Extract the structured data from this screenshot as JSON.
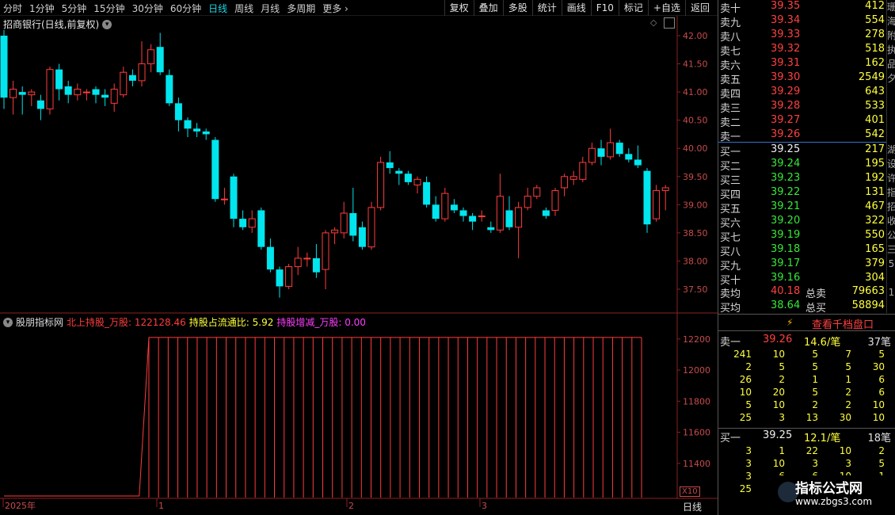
{
  "toolbar": {
    "periods": [
      "分时",
      "1分钟",
      "5分钟",
      "15分钟",
      "30分钟",
      "60分钟",
      "日线",
      "周线",
      "月线",
      "多周期",
      "更多"
    ],
    "active_period": "日线",
    "tools": [
      "复权",
      "叠加",
      "多股",
      "统计",
      "画线",
      "F10",
      "标记",
      "+自选",
      "返回"
    ]
  },
  "main_chart": {
    "title": "招商银行(日线,前复权)",
    "y_ticks": [
      "42.00",
      "41.50",
      "41.00",
      "40.50",
      "40.00",
      "39.50",
      "39.00",
      "38.50",
      "38.00",
      "37.50"
    ]
  },
  "chart_data": [
    {
      "type": "candlestick",
      "y_ticks": [
        42.0,
        41.5,
        41.0,
        40.5,
        40.0,
        39.5,
        39.0,
        38.5,
        38.0,
        37.5
      ],
      "ylim": [
        37.3,
        42.3
      ],
      "candles": [
        [
          42.0,
          40.9,
          42.1,
          40.7
        ],
        [
          40.9,
          41.05,
          41.2,
          40.6
        ],
        [
          41.0,
          40.95,
          41.1,
          40.6
        ],
        [
          40.95,
          41.0,
          41.05,
          40.75
        ],
        [
          40.85,
          40.7,
          40.95,
          40.5
        ],
        [
          40.7,
          41.4,
          41.45,
          40.6
        ],
        [
          41.4,
          41.05,
          41.5,
          40.85
        ],
        [
          41.1,
          40.95,
          41.2,
          40.8
        ],
        [
          40.95,
          41.05,
          41.15,
          40.85
        ],
        [
          41.0,
          41.0,
          41.05,
          40.85
        ],
        [
          41.05,
          40.95,
          41.1,
          40.8
        ],
        [
          40.95,
          40.9,
          41.05,
          40.75
        ],
        [
          40.8,
          41.05,
          41.15,
          40.65
        ],
        [
          40.95,
          41.35,
          41.45,
          40.9
        ],
        [
          41.3,
          41.2,
          41.4,
          41.1
        ],
        [
          41.2,
          41.5,
          41.9,
          41.1
        ],
        [
          41.5,
          41.75,
          41.85,
          41.35
        ],
        [
          41.8,
          41.35,
          42.05,
          41.3
        ],
        [
          41.3,
          40.8,
          41.4,
          40.75
        ],
        [
          40.8,
          40.5,
          40.9,
          40.3
        ],
        [
          40.5,
          40.35,
          40.55,
          40.2
        ],
        [
          40.35,
          40.3,
          40.45,
          40.2
        ],
        [
          40.3,
          40.25,
          40.35,
          40.15
        ],
        [
          40.15,
          39.1,
          40.2,
          39.05
        ],
        [
          39.1,
          39.1,
          39.3,
          39.0
        ],
        [
          39.5,
          38.75,
          39.55,
          38.6
        ],
        [
          38.75,
          38.6,
          38.9,
          38.55
        ],
        [
          38.6,
          38.75,
          38.9,
          38.5
        ],
        [
          38.9,
          38.25,
          38.95,
          38.2
        ],
        [
          38.25,
          37.85,
          38.4,
          37.8
        ],
        [
          37.85,
          37.55,
          37.9,
          37.35
        ],
        [
          37.55,
          37.9,
          37.95,
          37.5
        ],
        [
          37.9,
          38.05,
          38.25,
          37.75
        ],
        [
          38.05,
          38.05,
          38.15,
          37.9
        ],
        [
          38.05,
          37.8,
          38.3,
          37.7
        ],
        [
          37.85,
          38.5,
          38.55,
          37.5
        ],
        [
          38.5,
          38.55,
          38.6,
          38.3
        ],
        [
          38.5,
          38.85,
          39.05,
          38.4
        ],
        [
          38.85,
          38.45,
          39.3,
          38.35
        ],
        [
          38.6,
          38.25,
          38.7,
          38.2
        ],
        [
          38.25,
          38.95,
          39.05,
          38.2
        ],
        [
          38.95,
          39.75,
          39.85,
          38.9
        ],
        [
          39.75,
          39.65,
          39.95,
          39.55
        ],
        [
          39.6,
          39.55,
          39.65,
          39.35
        ],
        [
          39.55,
          39.4,
          39.6,
          39.35
        ],
        [
          39.35,
          39.45,
          39.5,
          39.2
        ],
        [
          39.4,
          39.0,
          39.5,
          38.95
        ],
        [
          39.0,
          38.75,
          39.15,
          38.7
        ],
        [
          38.75,
          39.2,
          39.3,
          38.7
        ],
        [
          39.0,
          38.9,
          39.1,
          38.85
        ],
        [
          38.9,
          38.8,
          38.95,
          38.7
        ],
        [
          38.8,
          38.7,
          38.85,
          38.55
        ],
        [
          38.8,
          38.8,
          38.9,
          38.7
        ],
        [
          38.6,
          38.55,
          38.7,
          38.5
        ],
        [
          38.55,
          39.15,
          39.55,
          38.5
        ],
        [
          38.9,
          38.6,
          39.15,
          38.55
        ],
        [
          38.6,
          38.95,
          39.05,
          38.05
        ],
        [
          38.95,
          39.15,
          39.3,
          38.9
        ],
        [
          39.15,
          39.3,
          39.35,
          39.1
        ],
        [
          38.9,
          38.8,
          38.95,
          38.75
        ],
        [
          38.9,
          39.25,
          39.3,
          38.8
        ],
        [
          39.3,
          39.5,
          39.55,
          39.15
        ],
        [
          39.45,
          39.5,
          39.6,
          39.35
        ],
        [
          39.45,
          39.75,
          39.85,
          39.4
        ],
        [
          39.75,
          40.0,
          40.1,
          39.7
        ],
        [
          40.0,
          39.85,
          40.15,
          39.7
        ],
        [
          39.85,
          40.1,
          40.35,
          39.8
        ],
        [
          40.1,
          39.9,
          40.15,
          39.85
        ],
        [
          39.9,
          39.8,
          40.0,
          39.75
        ],
        [
          39.8,
          39.7,
          40.05,
          39.65
        ],
        [
          39.6,
          38.65,
          39.65,
          38.5
        ],
        [
          38.75,
          39.25,
          39.35,
          38.7
        ],
        [
          39.25,
          39.3,
          39.35,
          38.9
        ]
      ]
    },
    {
      "type": "area",
      "y_ticks": [
        12200,
        12000,
        11800,
        11600,
        11400
      ],
      "ylim": [
        11180,
        12240
      ],
      "values": [
        11190,
        11190,
        11190,
        11190,
        11190,
        11190,
        11190,
        11190,
        11190,
        11190,
        11190,
        11190,
        11190,
        11190,
        11190,
        12210,
        12210,
        12210,
        12210,
        12210,
        12210,
        12210,
        12210,
        12210,
        12210,
        12210,
        12210,
        12210,
        12210,
        12210,
        12210,
        12210,
        12210,
        12210,
        12210,
        12210,
        12210,
        12210,
        12210,
        12210,
        12210,
        12210,
        12210,
        12210,
        12210,
        12210,
        12210,
        12210,
        12210,
        12210,
        12210,
        12210,
        12210,
        12210,
        12210,
        12210,
        12210,
        12210,
        12210,
        12210,
        12210,
        12210,
        12210,
        12210,
        12210,
        12210,
        12210
      ]
    }
  ],
  "indicator": {
    "name": "股朋指标网",
    "line1": "北上持股_万股: 122128.46",
    "line2": "持股占流通比: 5.92",
    "line3": "持股增减_万股: 0.00",
    "y_ticks": [
      "12200",
      "12000",
      "11800",
      "11600",
      "11400"
    ]
  },
  "x_axis": {
    "labels": [
      "2025年",
      "1",
      "2",
      "3"
    ],
    "scale": "X10",
    "tab": "日线"
  },
  "orderbook": {
    "asks": [
      {
        "label": "卖十",
        "price": "39.35",
        "vol": "412"
      },
      {
        "label": "卖九",
        "price": "39.34",
        "vol": "554"
      },
      {
        "label": "卖八",
        "price": "39.33",
        "vol": "278"
      },
      {
        "label": "卖七",
        "price": "39.32",
        "vol": "518"
      },
      {
        "label": "卖六",
        "price": "39.31",
        "vol": "162"
      },
      {
        "label": "卖五",
        "price": "39.30",
        "vol": "2549"
      },
      {
        "label": "卖四",
        "price": "39.29",
        "vol": "643"
      },
      {
        "label": "卖三",
        "price": "39.28",
        "vol": "533"
      },
      {
        "label": "卖二",
        "price": "39.27",
        "vol": "401"
      },
      {
        "label": "卖一",
        "price": "39.26",
        "vol": "542"
      }
    ],
    "bids": [
      {
        "label": "买一",
        "price": "39.25",
        "vol": "217"
      },
      {
        "label": "买二",
        "price": "39.24",
        "vol": "195"
      },
      {
        "label": "买三",
        "price": "39.23",
        "vol": "192"
      },
      {
        "label": "买四",
        "price": "39.22",
        "vol": "131"
      },
      {
        "label": "买五",
        "price": "39.21",
        "vol": "467"
      },
      {
        "label": "买六",
        "price": "39.20",
        "vol": "322"
      },
      {
        "label": "买七",
        "price": "39.19",
        "vol": "550"
      },
      {
        "label": "买八",
        "price": "39.18",
        "vol": "165"
      },
      {
        "label": "买九",
        "price": "39.17",
        "vol": "379"
      },
      {
        "label": "买十",
        "price": "39.16",
        "vol": "304"
      }
    ],
    "side_strip": [
      "珊",
      "海",
      "附",
      "执",
      "品",
      "夕",
      "",
      "",
      "",
      "",
      "湖",
      "设",
      "许",
      "指",
      "招",
      "收",
      "公",
      "三",
      "5",
      "",
      "1"
    ],
    "summary": {
      "ask_avg_label": "卖均",
      "ask_avg": "40.18",
      "ask_total_label": "总卖",
      "ask_total": "79663",
      "bid_avg_label": "买均",
      "bid_avg": "38.64",
      "bid_total_label": "总买",
      "bid_total": "58894"
    }
  },
  "queue": {
    "button": "查看千档盘口",
    "ask_head": {
      "label": "卖一",
      "price": "39.26",
      "per": "14.6/笔",
      "count": "37笔"
    },
    "ask_rows": [
      [
        "241",
        "10",
        "5",
        "7",
        "5"
      ],
      [
        "2",
        "5",
        "5",
        "5",
        "30"
      ],
      [
        "26",
        "2",
        "1",
        "1",
        "6"
      ],
      [
        "10",
        "20",
        "5",
        "2",
        "6"
      ],
      [
        "5",
        "10",
        "2",
        "2",
        "10"
      ],
      [
        "25",
        "3",
        "13",
        "30",
        "10"
      ]
    ],
    "bid_head": {
      "label": "买一",
      "price": "39.25",
      "per": "12.1/笔",
      "count": "18笔"
    },
    "bid_rows": [
      [
        "3",
        "1",
        "22",
        "10",
        "2"
      ],
      [
        "3",
        "10",
        "3",
        "3",
        "5"
      ],
      [
        "3",
        "6",
        "6",
        "10",
        "1"
      ],
      [
        "25",
        "",
        "",
        "",
        ""
      ]
    ]
  },
  "watermark": {
    "main": "指标公式网",
    "url": "www.zbgs3.com"
  }
}
